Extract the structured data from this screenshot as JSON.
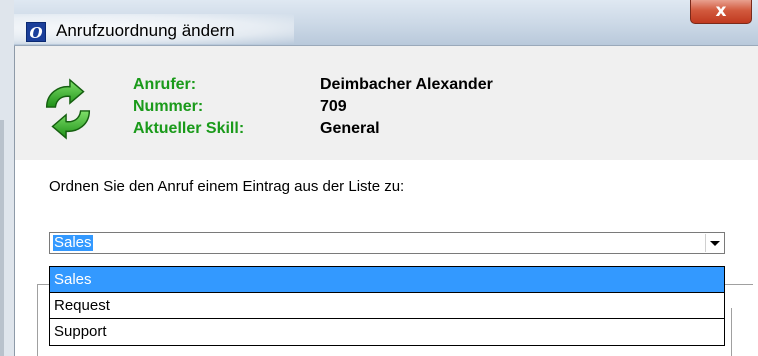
{
  "window": {
    "title": "Anrufzuordnung ändern",
    "app_icon_letter": "O",
    "close_symbol": "x"
  },
  "info": {
    "labels": {
      "caller": "Anrufer:",
      "number": "Nummer:",
      "skill": "Aktueller Skill:"
    },
    "values": {
      "caller": "Deimbacher Alexander",
      "number": "709",
      "skill": "General"
    },
    "icon": "refresh-arrows-icon",
    "label_color": "#1a9a1a"
  },
  "instruction": "Ordnen Sie den Anruf einem Eintrag aus der Liste zu:",
  "combo": {
    "selected": "Sales",
    "options": [
      "Sales",
      "Request",
      "Support"
    ],
    "highlight_color": "#3399ff"
  }
}
